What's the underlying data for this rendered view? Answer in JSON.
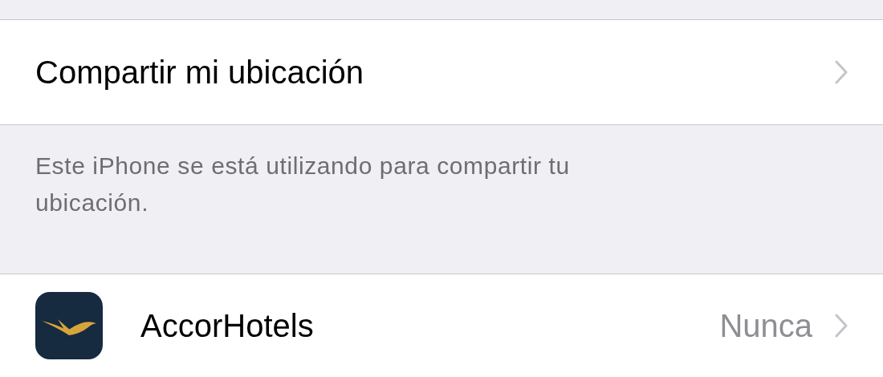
{
  "share_location": {
    "label": "Compartir mi ubicación"
  },
  "footer": "Este iPhone se está utilizando para compartir tu ubicación.",
  "apps": [
    {
      "name": "AccorHotels",
      "value": "Nunca"
    }
  ]
}
